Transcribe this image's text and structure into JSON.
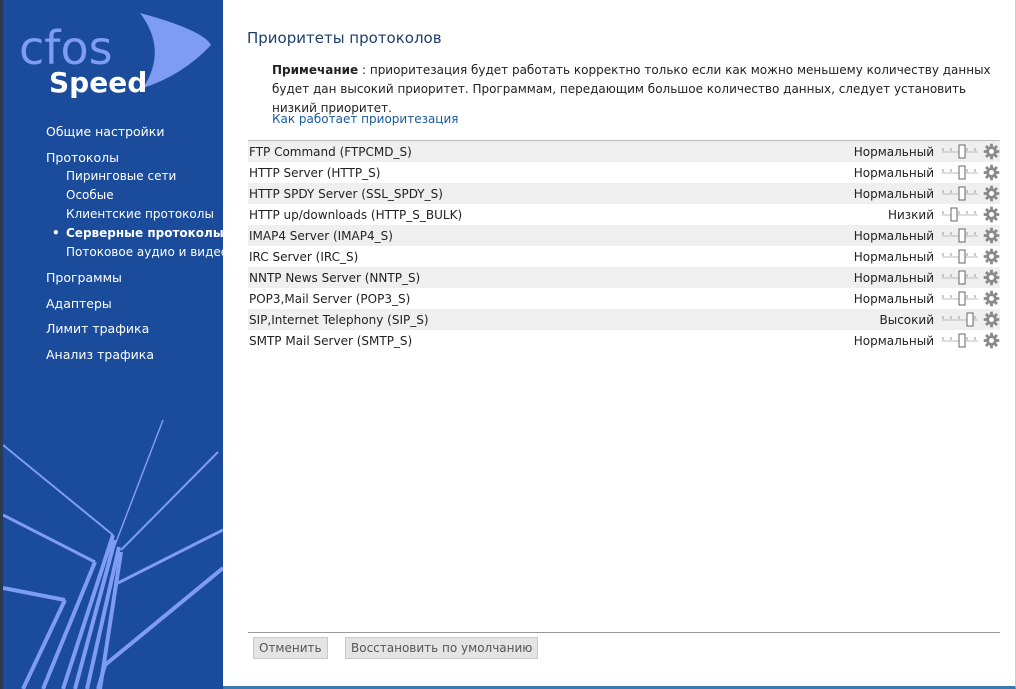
{
  "logo": {
    "top": "cfos",
    "bottom": "Speed"
  },
  "sidebar": {
    "items": [
      {
        "label": "Общие настройки",
        "level": 0
      },
      {
        "label": "Протоколы",
        "level": 0
      },
      {
        "label": "Пиринговые сети",
        "level": 1
      },
      {
        "label": "Особые",
        "level": 1
      },
      {
        "label": "Клиентские протоколы",
        "level": 1
      },
      {
        "label": "Серверные протоколы",
        "level": 1,
        "active": true
      },
      {
        "label": "Потоковое аудио и видео",
        "level": 1
      },
      {
        "label": "Программы",
        "level": 0
      },
      {
        "label": "Адаптеры",
        "level": 0
      },
      {
        "label": "Лимит трафика",
        "level": 0
      },
      {
        "label": "Анализ трафика",
        "level": 0
      }
    ]
  },
  "main": {
    "title": "Приоритеты протоколов",
    "note_label": "Примечание",
    "note_text": " : приоритезация будет работать корректно только если как можно меньшему количеству данных будет дан высокий приоритет. Программам, передающим большое количество данных, следует установить низкий приоритет.",
    "link": "Как работает приоритезация",
    "slider_max": 4,
    "rows": [
      {
        "name": "FTP Command (FTPCMD_S)",
        "priority": "Нормальный",
        "level": 2
      },
      {
        "name": "HTTP Server (HTTP_S)",
        "priority": "Нормальный",
        "level": 2
      },
      {
        "name": "HTTP SPDY Server (SSL_SPDY_S)",
        "priority": "Нормальный",
        "level": 2
      },
      {
        "name": "HTTP up/downloads (HTTP_S_BULK)",
        "priority": "Низкий",
        "level": 1
      },
      {
        "name": "IMAP4 Server (IMAP4_S)",
        "priority": "Нормальный",
        "level": 2
      },
      {
        "name": "IRC Server (IRC_S)",
        "priority": "Нормальный",
        "level": 2
      },
      {
        "name": "NNTP News Server (NNTP_S)",
        "priority": "Нормальный",
        "level": 2
      },
      {
        "name": "POP3,Mail Server (POP3_S)",
        "priority": "Нормальный",
        "level": 2
      },
      {
        "name": "SIP,Internet Telephony (SIP_S)",
        "priority": "Высокий",
        "level": 3
      },
      {
        "name": "SMTP Mail Server (SMTP_S)",
        "priority": "Нормальный",
        "level": 2
      }
    ],
    "cancel": "Отменить",
    "restore": "Восстановить по умолчанию"
  },
  "colors": {
    "sidebar": "#1b4b9b",
    "logo": "#7f9cf5",
    "accent": "#1a5aa0"
  }
}
